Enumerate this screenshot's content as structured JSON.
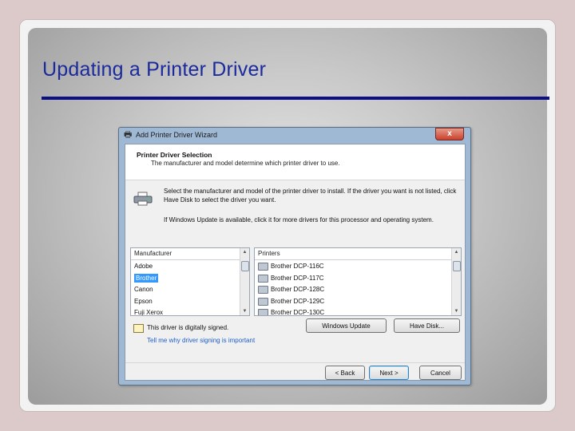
{
  "slide": {
    "title": "Updating a Printer Driver"
  },
  "dialog": {
    "title": "Add Printer Driver Wizard",
    "close_label": "x",
    "header": {
      "title": "Printer Driver Selection",
      "subtitle": "The manufacturer and model determine which printer driver to use."
    },
    "instructions": [
      "Select the manufacturer and model of the printer driver to install. If the driver you want is not listed, click Have Disk to select the driver you want.",
      "If Windows Update is available, click it for more drivers for this processor and operating system."
    ],
    "manufacturer": {
      "header": "Manufacturer",
      "items": [
        "Adobe",
        "Brother",
        "Canon",
        "Epson",
        "Fuji Xerox"
      ],
      "selected": "Brother"
    },
    "printers": {
      "header": "Printers",
      "items": [
        "Brother DCP-116C",
        "Brother DCP-117C",
        "Brother DCP-128C",
        "Brother DCP-129C",
        "Brother DCP-130C"
      ]
    },
    "signing": {
      "status": "This driver is digitally signed.",
      "link": "Tell me why driver signing is important"
    },
    "buttons": {
      "windows_update": "Windows Update",
      "have_disk": "Have Disk...",
      "back": "< Back",
      "next": "Next >",
      "cancel": "Cancel"
    }
  },
  "colors": {
    "title_text": "#1b2a9c",
    "title_rule": "#0d1080",
    "selection": "#3399ff",
    "link": "#1b5ec9"
  }
}
